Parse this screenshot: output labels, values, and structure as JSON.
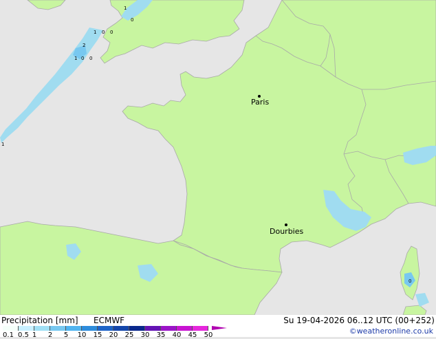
{
  "colors": {
    "sea": "#e6e6e6",
    "land": "#c8f5a0",
    "border": "#a8a8a8",
    "precip_light": "#a0dcf0",
    "precip_med": "#78c8f0"
  },
  "cities": [
    {
      "name": "Paris",
      "icon": "city-dot-icon"
    },
    {
      "name": "Dourbies",
      "icon": "city-dot-icon"
    }
  ],
  "cell_labels": [
    "1",
    "1",
    "0",
    "0",
    "1",
    "0",
    "0",
    "2",
    "1",
    "0",
    "0"
  ],
  "legend": {
    "title": "Precipitation [mm]",
    "model": "ECMWF",
    "datetime": "Su 19-04-2026 06..12 UTC (00+252)",
    "credit": "©weatheronline.co.uk",
    "tick_labels": [
      "0.1",
      "0.5",
      "1",
      "2",
      "5",
      "10",
      "15",
      "20",
      "25",
      "30",
      "35",
      "40",
      "45",
      "50"
    ],
    "scale_colors": [
      "#f5fffa",
      "#c8f0ff",
      "#a0e0f5",
      "#78c8f0",
      "#50b4f0",
      "#2d8cdc",
      "#1e64c8",
      "#1446aa",
      "#0a288c",
      "#6414b4",
      "#9b14c8",
      "#c814d2",
      "#e628dc"
    ]
  }
}
